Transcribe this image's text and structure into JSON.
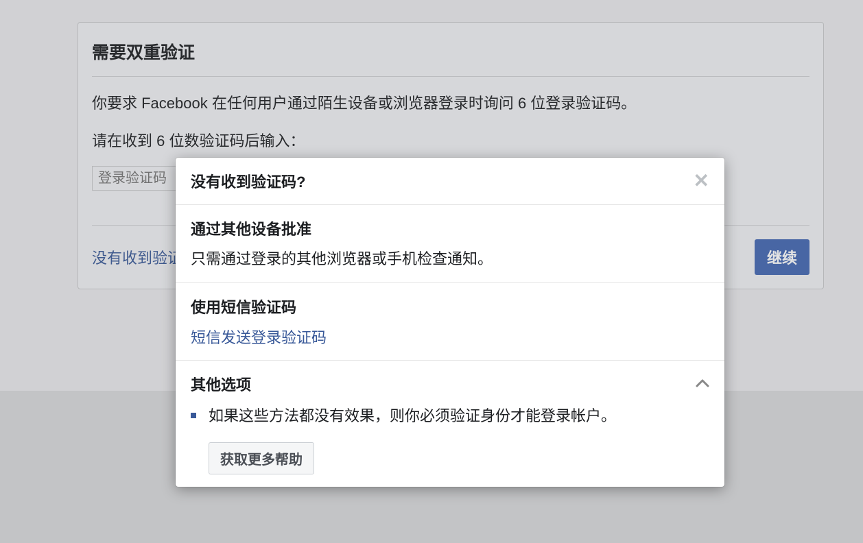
{
  "card": {
    "title": "需要双重验证",
    "desc1": "你要求 Facebook 在任何用户通过陌生设备或浏览器登录时询问 6 位登录验证码。",
    "desc2": "请在收到 6 位数验证码后输入：",
    "code_placeholder": "登录验证码",
    "no_code_link": "没有收到验证码",
    "continue_label": "继续"
  },
  "modal": {
    "title": "没有收到验证码?",
    "sections": {
      "approve": {
        "heading": "通过其他设备批准",
        "text": "只需通过登录的其他浏览器或手机检查通知。"
      },
      "sms": {
        "heading": "使用短信验证码",
        "link": "短信发送登录验证码"
      },
      "other": {
        "heading": "其他选项",
        "bullet": "如果这些方法都没有效果，则你必须验证身份才能登录帐户。",
        "more_help_label": "获取更多帮助"
      }
    }
  }
}
